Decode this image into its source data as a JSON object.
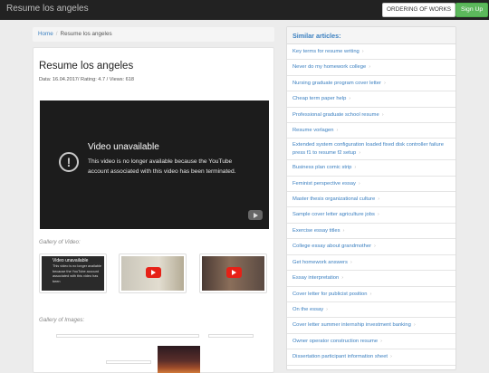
{
  "header": {
    "brand": "Resume los angeles",
    "order_label": "ORDERING OF WORKS",
    "signup_label": "Sign Up"
  },
  "breadcrumb": {
    "home": "Home",
    "current": "Resume los angeles"
  },
  "article": {
    "title": "Resume los angeles",
    "meta": "Data: 16.04.2017/ Rating: 4.7 / Views: 618"
  },
  "video": {
    "heading": "Video unavailable",
    "message": "This video is no longer available because the YouTube account associated with this video has been terminated."
  },
  "gallery_video_label": "Gallery of Video:",
  "thumb1": {
    "heading": "Video unavailable",
    "text": "This video is no longer available because the YouTube account associated with this video has been"
  },
  "gallery_images_label": "Gallery of Images:",
  "sidebar": {
    "heading": "Similar articles:",
    "items": [
      {
        "label": "Key terms for resume writing"
      },
      {
        "label": "Never do my homework college"
      },
      {
        "label": "Nursing graduate program cover letter"
      },
      {
        "label": "Cheap term paper help"
      },
      {
        "label": "Professional graduate school resume"
      },
      {
        "label": "Resume vorlagen"
      },
      {
        "label": "Extended system configuration loaded fixed disk controller failure press f1 to resume f2 setup"
      },
      {
        "label": "Business plan comic strip"
      },
      {
        "label": "Feminist perspective essay"
      },
      {
        "label": "Master thesis organizational culture"
      },
      {
        "label": "Sample cover letter agriculture jobs"
      },
      {
        "label": "Exercise essay titles"
      },
      {
        "label": "College essay about grandmother"
      },
      {
        "label": "Get homework answers"
      },
      {
        "label": "Essay interpretation"
      },
      {
        "label": "Cover letter for publicist position"
      },
      {
        "label": "On the essay"
      },
      {
        "label": "Cover letter summer internship investment banking"
      },
      {
        "label": "Owner operator construction resume"
      },
      {
        "label": "Dissertation participant information sheet"
      }
    ]
  },
  "colors": {
    "link": "#3a7fc0",
    "signup": "#5cb85c",
    "topbar": "#222222"
  }
}
